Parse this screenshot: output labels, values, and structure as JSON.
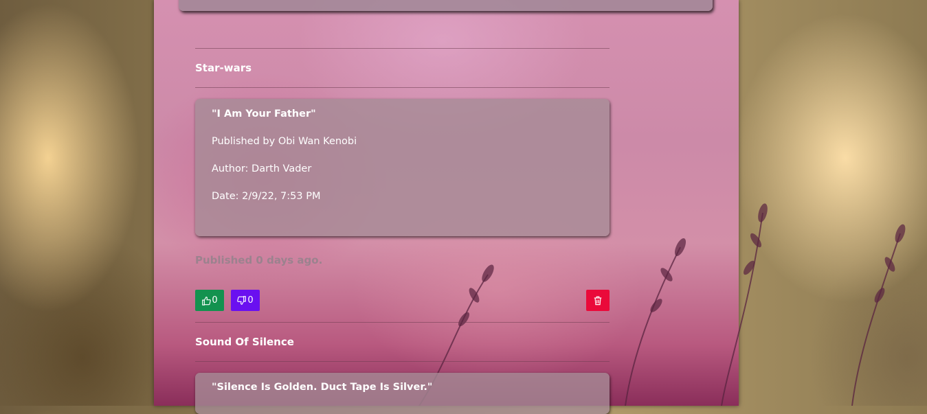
{
  "posts": [
    {
      "category": "Star-wars",
      "quote": "\"I Am Your Father\"",
      "published_by": "Published by Obi Wan Kenobi",
      "author": "Author: Darth Vader",
      "date": "Date: 2/9/22, 7:53 PM",
      "published_ago": "Published 0 days ago.",
      "likes": "0",
      "dislikes": "0"
    },
    {
      "category": "Sound Of Silence",
      "quote": "\"Silence Is Golden. Duct Tape Is Silver.\""
    }
  ],
  "icons": {
    "like": "thumbs-up-icon",
    "dislike": "thumbs-down-icon",
    "delete": "trash-icon"
  },
  "colors": {
    "like_button": "#13924f",
    "dislike_button": "#6a10f0",
    "delete_button": "#ea0a3a"
  }
}
